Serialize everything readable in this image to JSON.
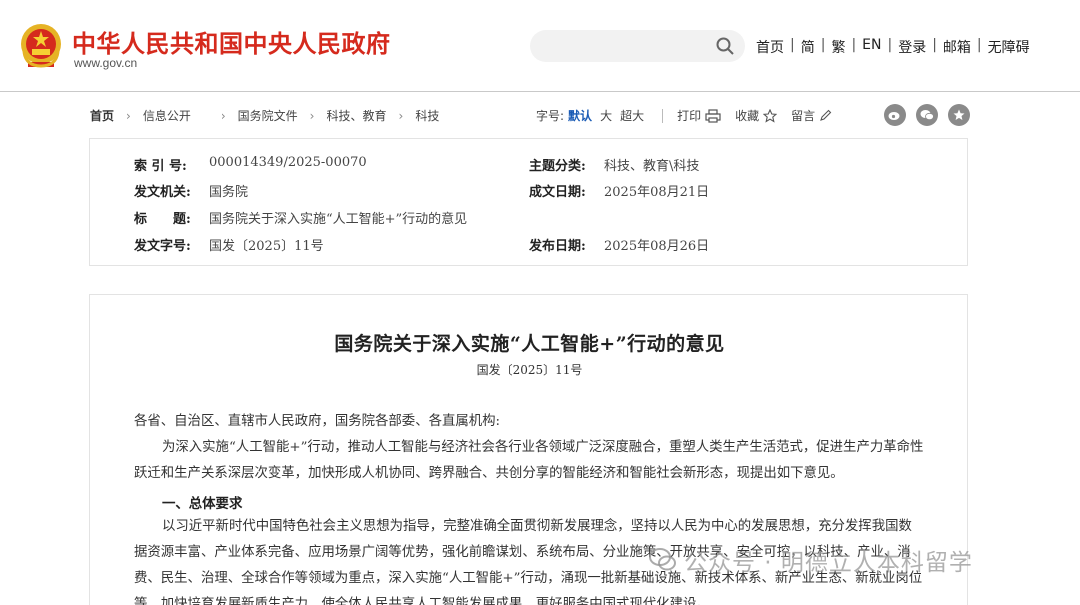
{
  "header": {
    "title": "中华人民共和国中央人民政府",
    "url": "www.gov.cn",
    "nav": [
      "首页",
      "简",
      "繁",
      "EN",
      "登录",
      "邮箱",
      "无障碍"
    ]
  },
  "breadcrumb": [
    "首页",
    "信息公开",
    "国务院文件",
    "科技、教育",
    "科技"
  ],
  "tools": {
    "font_label": "字号:",
    "font_default": "默认",
    "font_large": "大",
    "font_xlarge": "超大",
    "print": "打印",
    "favorite": "收藏",
    "comment": "留言"
  },
  "info": {
    "index_no_label": "索 引 号:",
    "index_no": "000014349/2025-00070",
    "topic_label": "主题分类:",
    "topic": "科技、教育\\科技",
    "issuer_label": "发文机关:",
    "issuer": "国务院",
    "created_label": "成文日期:",
    "created": "2025年08月21日",
    "subject_label": "标　　题:",
    "subject": "国务院关于深入实施“人工智能+”行动的意见",
    "doc_no_label": "发文字号:",
    "doc_no": "国发〔2025〕11号",
    "published_label": "发布日期:",
    "published": "2025年08月26日"
  },
  "article": {
    "title": "国务院关于深入实施“人工智能+”行动的意见",
    "doc_no": "国发〔2025〕11号",
    "salutation": "各省、自治区、直辖市人民政府，国务院各部委、各直属机构:",
    "para1": "为深入实施“人工智能+”行动，推动人工智能与经济社会各行业各领域广泛深度融合，重塑人类生产生活范式，促进生产力革命性跃迁和生产关系深层次变革，加快形成人机协同、跨界融合、共创分享的智能经济和智能社会新形态，现提出如下意见。",
    "section1": "一、总体要求",
    "para2": "以习近平新时代中国特色社会主义思想为指导，完整准确全面贯彻新发展理念，坚持以人民为中心的发展思想，充分发挥我国数据资源丰富、产业体系完备、应用场景广阔等优势，强化前瞻谋划、系统布局、分业施策、开放共享、安全可控，以科技、产业、消费、民生、治理、全球合作等领域为重点，深入实施“人工智能+”行动，涌现一批新基础设施、新技术体系、新产业生态、新就业岗位等，加快培育发展新质生产力，使全体人民共享人工智能发展成果，更好服务中国式现代化建设。"
  },
  "watermark": "公众号 · 明德立人本科留学",
  "colors": {
    "brand_red": "#d52a1d",
    "accent_blue": "#1a5bb5"
  }
}
